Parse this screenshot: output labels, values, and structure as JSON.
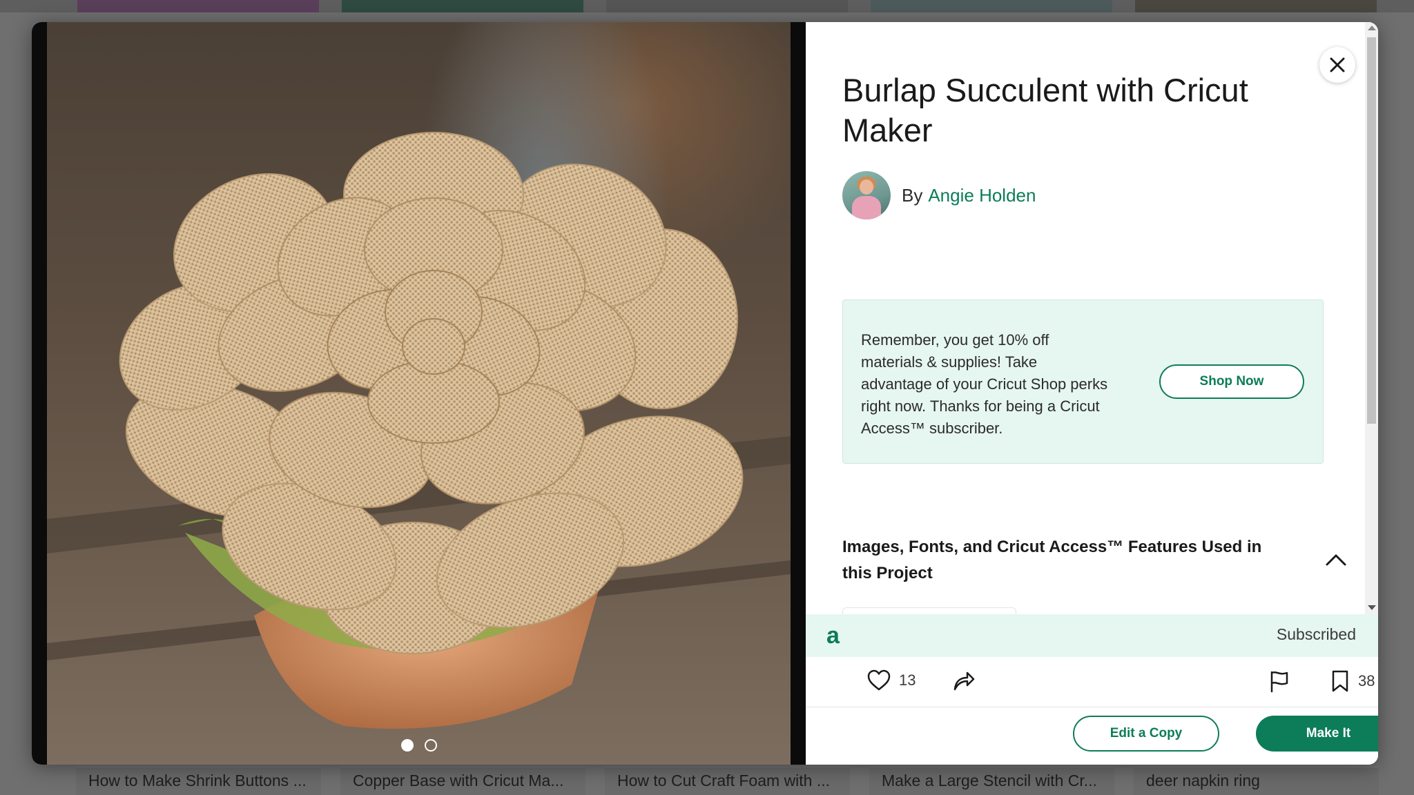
{
  "project": {
    "title": "Burlap Succulent with Cricut Maker",
    "by_label": "By",
    "author": "Angie Holden"
  },
  "promo": {
    "text": "Remember, you get 10% off materials & supplies! Take advantage of your Cricut Shop perks right now. Thanks for being a Cricut Access™ subscriber.",
    "button": "Shop Now"
  },
  "features": {
    "heading": "Images, Fonts, and Cricut Access™ Features Used in this Project"
  },
  "access": {
    "logo": "a",
    "status": "Subscribed"
  },
  "actions": {
    "likes": "13",
    "saves": "38"
  },
  "footer": {
    "edit": "Edit a Copy",
    "make": "Make It"
  },
  "background_cards": [
    "How to Make Shrink Buttons ...",
    "Copper Base with Cricut Ma...",
    "How to Cut Craft Foam with ...",
    "Make a Large Stencil with Cr...",
    "deer napkin ring"
  ],
  "image": {
    "slide_count": 2,
    "active_slide": 1
  },
  "colors": {
    "brand_green": "#0c7c59",
    "promo_bg": "#e6f6f1"
  }
}
